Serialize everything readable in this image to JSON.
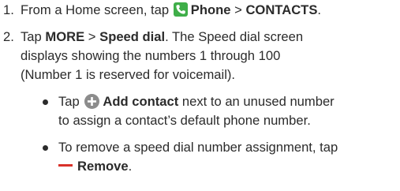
{
  "steps": [
    {
      "number": "1.",
      "text_before": "From a Home screen, tap",
      "phone_label": "Phone",
      "separator": ">",
      "contacts_label": "CONTACTS",
      "end": "."
    },
    {
      "number": "2.",
      "text_tap": "Tap",
      "more_label": "MORE",
      "separator": ">",
      "speed_dial_label": "Speed dial",
      "text_after_1": ". The Speed dial screen",
      "line2": "displays showing the numbers 1 through 100",
      "line3": "(Number 1 is reserved for voicemail)."
    }
  ],
  "bullets": [
    {
      "text_tap": "Tap",
      "add_label": "Add contact",
      "text_after": "next to an unused number",
      "line2": "to assign a contact’s default phone number."
    },
    {
      "line1": "To remove a speed dial number assignment, tap",
      "remove_label": "Remove",
      "end": "."
    }
  ],
  "icons": {
    "phone": "phone-icon",
    "add": "add-circle-icon",
    "remove": "minus-icon"
  },
  "colors": {
    "text": "#2b2b2b",
    "phone_icon_bg": "#3fae49",
    "add_icon_bg": "#8c8c8c",
    "remove_icon": "#d9322a"
  }
}
